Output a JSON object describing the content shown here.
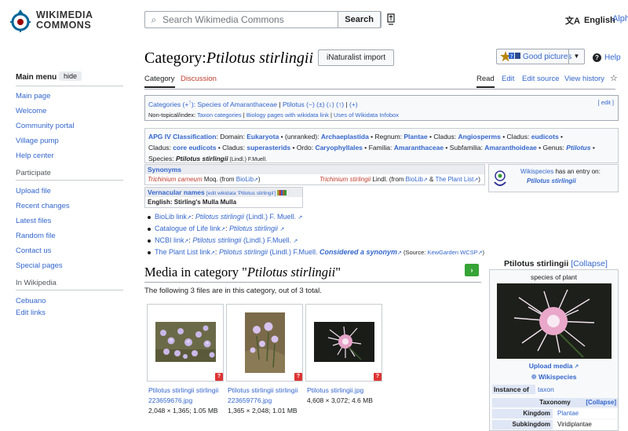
{
  "header": {
    "logo_line1": "WIKIMEDIA",
    "logo_line2": "COMMONS",
    "search_placeholder": "Search Wikimedia Commons",
    "search_button": "Search",
    "language": "English",
    "alph": "Alph"
  },
  "sidebar": {
    "title": "Main menu",
    "hide": "hide",
    "items": [
      "Main page",
      "Welcome",
      "Community portal",
      "Village pump",
      "Help center"
    ],
    "participate_heading": "Participate",
    "participate_items": [
      "Upload file",
      "Recent changes",
      "Latest files",
      "Random file",
      "Contact us",
      "Special pages"
    ],
    "wikipedia_heading": "In Wikipedia",
    "wikipedia_items": [
      "Cebuano",
      "Edit links"
    ]
  },
  "page": {
    "title_ns": "Category:",
    "title_name": "Ptilotus stirlingii",
    "inat_button": "iNaturalist import",
    "good_pictures": "Good pictures",
    "help": "Help",
    "tabs": {
      "category": "Category",
      "discussion": "Discussion",
      "read": "Read",
      "edit": "Edit",
      "edit_source": "Edit source",
      "history": "View history"
    }
  },
  "catlinks": {
    "label": "Categories",
    "plus": "(+",
    "plus_up": "↑",
    "plus_end": "): ",
    "cat1": "Species of Amaranthaceae",
    "cat2": "Ptilotus",
    "cat2_ctrl": " (−) (±) (↓) (↑)",
    "add": "(+)",
    "edit": "[ edit ]",
    "hidden_label": "Non-topical/index: ",
    "hidden1": "Taxon categories",
    "hidden2": "Biology pages with wikidata link",
    "hidden3": "Uses of Wikidata Infobox"
  },
  "apg": {
    "label": "APG IV Classification",
    "domain_k": "Domain: ",
    "domain_v": "Eukaryota",
    "unranked_k": "(unranked): ",
    "unranked_v": "Archaeplastida",
    "regnum_k": "Regnum: ",
    "regnum_v": "Plantae",
    "cladus1_k": "Cladus: ",
    "cladus1_v": "Angiosperms",
    "cladus2_k": "Cladus: ",
    "cladus2_v": "eudicots",
    "cladus3_k": "Cladus: ",
    "cladus3_v": "core eudicots",
    "cladus4_k": "Cladus: ",
    "cladus4_v": "superasterids",
    "ordo_k": "Ordo: ",
    "ordo_v": "Caryophyllales",
    "familia_k": "Familia: ",
    "familia_v": "Amaranthaceae",
    "subfamilia_k": "Subfamilia: ",
    "subfamilia_v": "Amaranthoideae",
    "genus_k": "Genus: ",
    "genus_v": "Ptilotus",
    "species_k": "Species: ",
    "species_v": "Ptilotus stirlingii",
    "species_author": " (Lindl.) F.Muell."
  },
  "synonyms": {
    "title": "Synonyms",
    "syn1_name": "Trichinium carneum",
    "syn1_auth": " Moq. (from ",
    "syn1_src": "BioLib",
    "syn1_end": ")",
    "syn2_name": "Trichinium stirlingii",
    "syn2_auth": " Lindl. (from ",
    "syn2_src1": "BioLib",
    "syn2_mid": " & ",
    "syn2_src2": "The Plant List",
    "syn2_end": ")"
  },
  "wikispecies_box": {
    "link": "Wikispecies",
    "text": " has an entry on:",
    "entry": "Ptilotus stirlingii"
  },
  "vernacular": {
    "title": "Vernacular names",
    "edit": "[edit wikidata 'Ptilotus stirlingii']",
    "entry": "English: Stirling's Mulla Mulla"
  },
  "links": [
    {
      "label": "BioLib link",
      "name": "Ptilotus stirlingii",
      "author": " (Lindl.) F. Muell."
    },
    {
      "label": "Catalogue of Life link",
      "name": "Ptilotus stirlingii",
      "author": ""
    },
    {
      "label": "NCBI link",
      "name": "Ptilotus stirlingii",
      "author": " (Lindl.) F.Muell."
    },
    {
      "label": "The Plant List link",
      "name": "Ptilotus stirlingii",
      "author": " (Lindl.) F.Muell.",
      "extra": "Considered a synonym",
      "source": " (Source: ",
      "source_link": "KewGarden WCSP",
      "source_end": ")"
    }
  ],
  "media": {
    "heading_pre": "Media in category \"",
    "heading_name": "Ptilotus stirlingii",
    "heading_post": "\"",
    "count_text": "The following 3 files are in this category, out of 3 total.",
    "files": [
      {
        "name": "Ptilotus stirlingii stirlingii 223659676.jpg",
        "meta": "2,048 × 1,365; 1.05 MB"
      },
      {
        "name": "Ptilotus stirlingii stirlingii 223659776.jpg",
        "meta": "1,365 × 2,048; 1.01 MB"
      },
      {
        "name": "Ptilotus stirlingii.jpg",
        "meta": "4,608 × 3,072; 4.6 MB"
      }
    ]
  },
  "infobox": {
    "title": "Ptilotus stirlingii",
    "collapse": "[Collapse]",
    "subtitle": "species of plant",
    "upload": "Upload media",
    "wikispecies": "Wikispecies",
    "instance_k": "Instance of",
    "instance_v": "taxon",
    "taxonomy": "Taxonomy",
    "taxonomy_collapse": "[Collapse]",
    "kingdom_k": "Kingdom",
    "kingdom_v": "Plantae",
    "subkingdom_k": "Subkingdom",
    "subkingdom_v": "Viridiplantae"
  },
  "colors": {
    "link": "#3366cc",
    "redlink": "#bf3c2c",
    "border": "#a2a9b1"
  }
}
